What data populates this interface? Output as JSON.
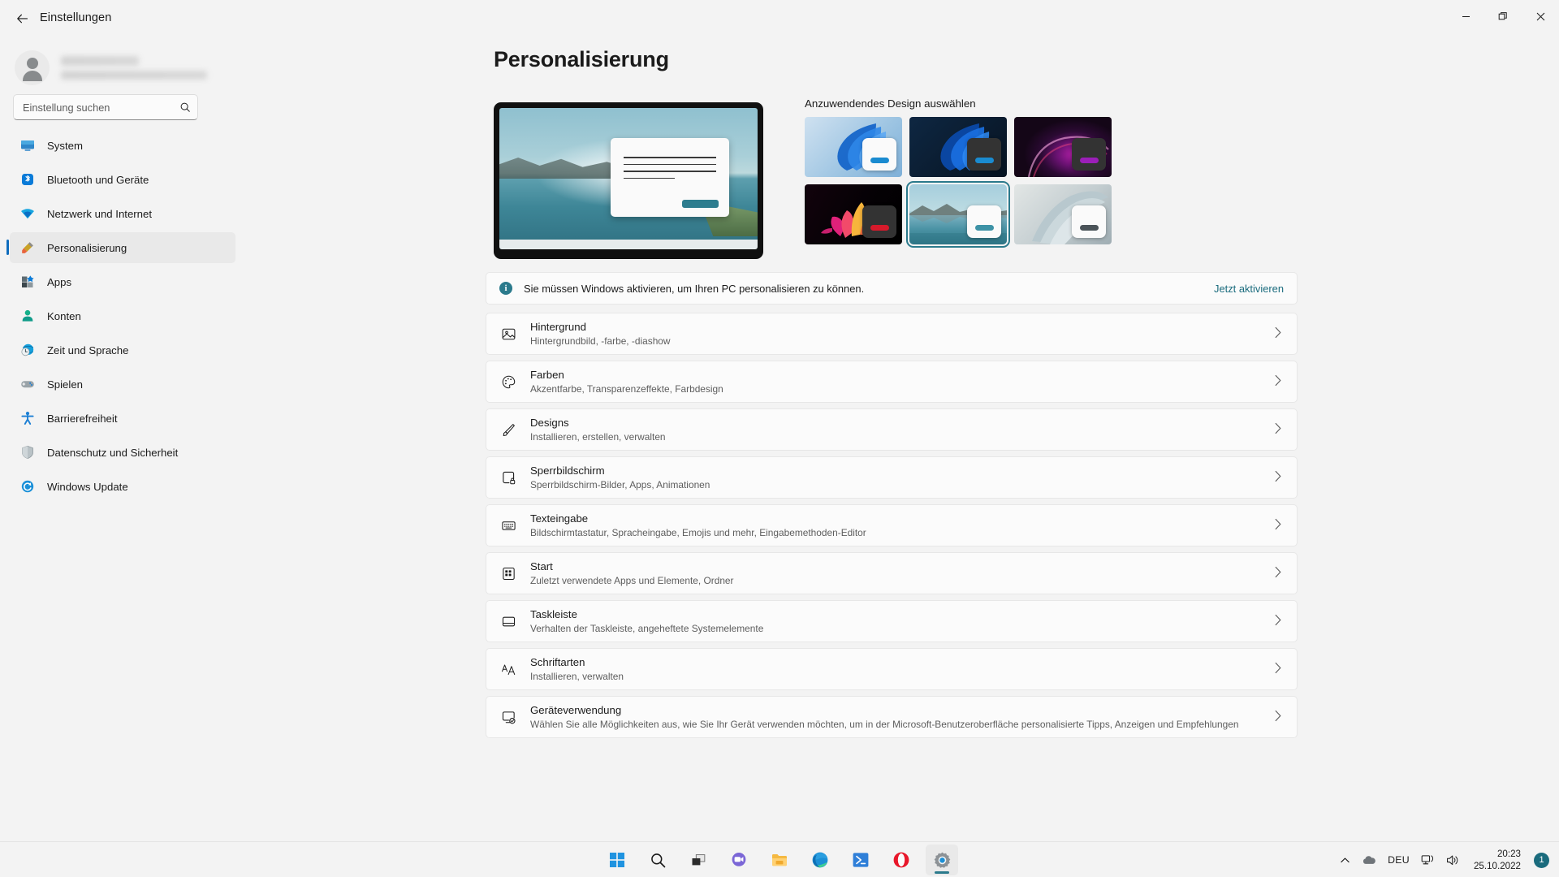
{
  "window": {
    "title": "Einstellungen",
    "back_icon": "arrow-left-icon",
    "minimize_label": "—",
    "maximize_label": "❐",
    "close_label": "✕"
  },
  "sidebar": {
    "account": {
      "name": "",
      "email": ""
    },
    "search": {
      "placeholder": "Einstellung suchen",
      "value": "",
      "icon": "search-icon"
    },
    "items": [
      {
        "label": "System",
        "icon": "monitor-icon",
        "active": false
      },
      {
        "label": "Bluetooth und Geräte",
        "icon": "bluetooth-icon",
        "active": false
      },
      {
        "label": "Netzwerk und Internet",
        "icon": "wifi-icon",
        "active": false
      },
      {
        "label": "Personalisierung",
        "icon": "paintbrush-icon",
        "active": true
      },
      {
        "label": "Apps",
        "icon": "apps-icon",
        "active": false
      },
      {
        "label": "Konten",
        "icon": "person-icon",
        "active": false
      },
      {
        "label": "Zeit und Sprache",
        "icon": "clock-globe-icon",
        "active": false
      },
      {
        "label": "Spielen",
        "icon": "gamepad-icon",
        "active": false
      },
      {
        "label": "Barrierefreiheit",
        "icon": "accessibility-icon",
        "active": false
      },
      {
        "label": "Datenschutz und Sicherheit",
        "icon": "shield-icon",
        "active": false
      },
      {
        "label": "Windows Update",
        "icon": "update-icon",
        "active": false
      }
    ]
  },
  "main": {
    "page_title": "Personalisierung",
    "themes_label": "Anzuwendendes Design auswählen",
    "themes": [
      {
        "name": "windows-light-bloom",
        "selected": false,
        "bg_from": "#bcd7ea",
        "bg_to": "#8fbede",
        "accent": "#1a8bd0",
        "mini_bg": "#fafafa"
      },
      {
        "name": "windows-dark-bloom",
        "selected": false,
        "bg_from": "#0d2036",
        "bg_to": "#091a2c",
        "accent": "#1a8bd0",
        "mini_bg": "#333333"
      },
      {
        "name": "glow-dark",
        "selected": false,
        "bg_from": "#2a0f2c",
        "bg_to": "#14061a",
        "accent": "#9b1fb8",
        "mini_bg": "#333333"
      },
      {
        "name": "captured-motion",
        "selected": false,
        "bg_from": "#0b0208",
        "bg_to": "#000000",
        "accent": "#d61a2b",
        "mini_bg": "#333333"
      },
      {
        "name": "sunrise-lake",
        "selected": true,
        "bg_from": "#9ecbd8",
        "bg_to": "#2f7081",
        "accent": "#3d92a6",
        "mini_bg": "#fafafa"
      },
      {
        "name": "flow-light",
        "selected": false,
        "bg_from": "#d5dad9",
        "bg_to": "#aab7bb",
        "accent": "#4a5358",
        "mini_bg": "#fafafa"
      }
    ],
    "banner": {
      "icon": "info-icon",
      "text": "Sie müssen Windows aktivieren, um Ihren PC personalisieren zu können.",
      "link": "Jetzt aktivieren"
    },
    "rows": [
      {
        "title": "Hintergrund",
        "sub": "Hintergrundbild, -farbe, -diashow",
        "icon": "image-icon",
        "chevron": "chevron-right-icon"
      },
      {
        "title": "Farben",
        "sub": "Akzentfarbe, Transparenzeffekte, Farbdesign",
        "icon": "palette-icon",
        "chevron": "chevron-right-icon"
      },
      {
        "title": "Designs",
        "sub": "Installieren, erstellen, verwalten",
        "icon": "paintbrush-icon",
        "chevron": "chevron-right-icon"
      },
      {
        "title": "Sperrbildschirm",
        "sub": "Sperrbildschirm-Bilder, Apps, Animationen",
        "icon": "lockscreen-icon",
        "chevron": "chevron-right-icon"
      },
      {
        "title": "Texteingabe",
        "sub": "Bildschirmtastatur, Spracheingabe, Emojis und mehr, Eingabemethoden-Editor",
        "icon": "keyboard-icon",
        "chevron": "chevron-right-icon"
      },
      {
        "title": "Start",
        "sub": "Zuletzt verwendete Apps und Elemente, Ordner",
        "icon": "start-icon",
        "chevron": "chevron-right-icon"
      },
      {
        "title": "Taskleiste",
        "sub": "Verhalten der Taskleiste, angeheftete Systemelemente",
        "icon": "taskbar-icon",
        "chevron": "chevron-right-icon"
      },
      {
        "title": "Schriftarten",
        "sub": "Installieren, verwalten",
        "icon": "fonts-icon",
        "chevron": "chevron-right-icon"
      },
      {
        "title": "Geräteverwendung",
        "sub": "Wählen Sie alle Möglichkeiten aus, wie Sie Ihr Gerät verwenden möchten, um in der Microsoft-Benutzeroberfläche personalisierte Tipps, Anzeigen und Empfehlungen",
        "icon": "device-usage-icon",
        "chevron": "chevron-right-icon"
      }
    ]
  },
  "taskbar": {
    "items": [
      {
        "name": "start-icon",
        "active": false,
        "underline": false
      },
      {
        "name": "search-icon",
        "active": false,
        "underline": false
      },
      {
        "name": "task-view-icon",
        "active": false,
        "underline": false
      },
      {
        "name": "chat-icon",
        "active": false,
        "underline": true
      },
      {
        "name": "file-explorer-icon",
        "active": false,
        "underline": false
      },
      {
        "name": "edge-icon",
        "active": false,
        "underline": false
      },
      {
        "name": "terminal-icon",
        "active": false,
        "underline": true
      },
      {
        "name": "opera-icon",
        "active": false,
        "underline": false
      },
      {
        "name": "settings-icon",
        "active": true,
        "underline": true
      }
    ],
    "tray": {
      "chevron": "chevron-up-icon",
      "onedrive": "cloud-icon",
      "language": "DEU",
      "network": "network-icon",
      "volume": "volume-icon",
      "time": "20:23",
      "date": "25.10.2022",
      "notification_count": "1"
    }
  },
  "colors": {
    "accent": "#2b7a8c",
    "selection": "#0f6cbd",
    "link": "#1a6b7d"
  }
}
